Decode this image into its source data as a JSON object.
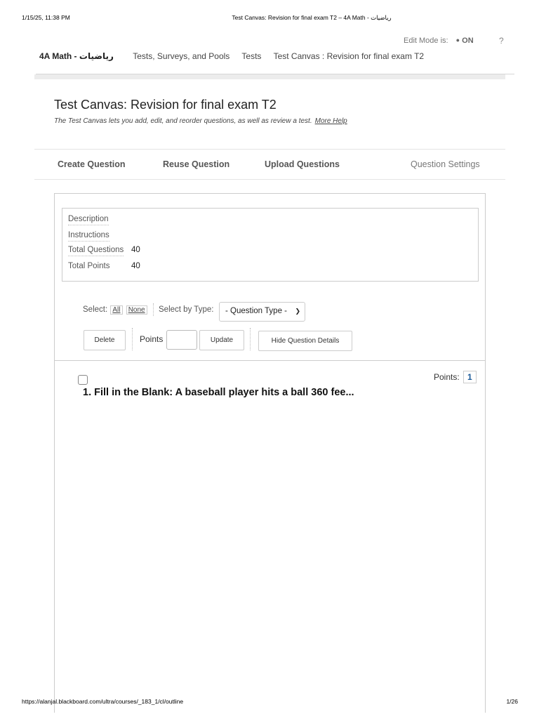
{
  "print": {
    "datetime": "1/15/25, 11:38 PM",
    "doc_title": "Test Canvas: Revision for final exam T2 – 4A Math - رياضيات",
    "url": "https://alanjal.blackboard.com/ultra/courses/_183_1/cl/outline",
    "page": "1/26"
  },
  "edit_mode": {
    "label": "Edit Mode is:",
    "state": "ON",
    "help": "?"
  },
  "breadcrumb": {
    "course": "4A Math - رياضيات",
    "items": [
      "Tests, Surveys, and Pools",
      "Tests",
      "Test Canvas : Revision for final exam T2"
    ]
  },
  "page": {
    "title": "Test Canvas: Revision for final exam T2",
    "subtitle": "The Test Canvas lets you add, edit, and reorder questions, as well as review a test.",
    "more_help": "More Help"
  },
  "actions": {
    "create": "Create Question",
    "reuse": "Reuse Question",
    "upload": "Upload Questions",
    "settings": "Question Settings"
  },
  "info": {
    "description_label": "Description",
    "instructions_label": "Instructions",
    "total_questions_label": "Total Questions",
    "total_questions": "40",
    "total_points_label": "Total Points",
    "total_points": "40"
  },
  "selection": {
    "select_label": "Select:",
    "all": "All",
    "none": "None",
    "by_type_label": "Select by Type:",
    "type_value": "- Question Type -"
  },
  "buttons": {
    "delete": "Delete",
    "points_label": "Points",
    "update": "Update",
    "hide_details": "Hide Question Details"
  },
  "question": {
    "title": "1. Fill in the Blank: A baseball player hits a ball 360 fee...",
    "points_label": "Points:",
    "points": "1"
  }
}
